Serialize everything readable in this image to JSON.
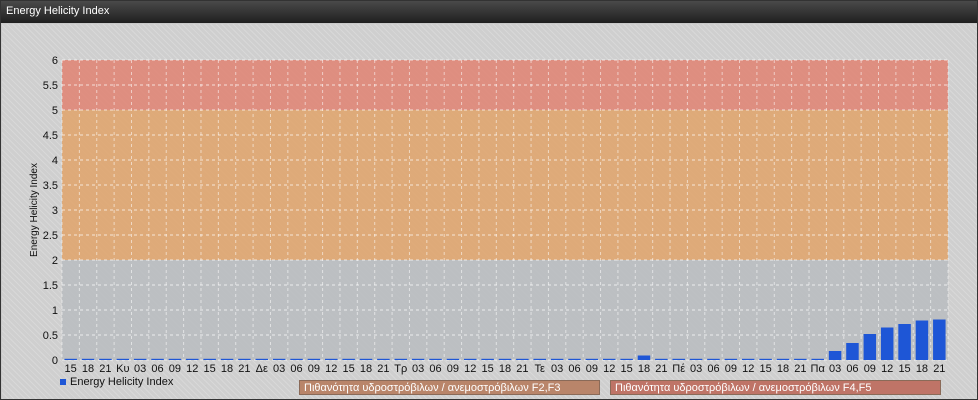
{
  "window": {
    "title": "Energy Helicity Index"
  },
  "legend": {
    "series_label": "Energy Helicity Index"
  },
  "bands": [
    {
      "label": "Πιθανότητα υδροστρόβιλων / ανεμοστρόβιλων F2,F3",
      "color": "#b9856a"
    },
    {
      "label": "Πιθανότητα υδροστρόβιλων / ανεμοστρόβιλων F4,F5",
      "color": "#bf7467"
    }
  ],
  "colors": {
    "bar": "#1e56d6",
    "band_low": "#e0a772",
    "band_high": "#e0897a"
  },
  "chart_data": {
    "type": "bar",
    "title": "",
    "ylabel": "Energy Helicity Index",
    "xlabel": "",
    "ylim": [
      0,
      6
    ],
    "yticks": [
      "0",
      "0.5",
      "1",
      "1.5",
      "2",
      "2.5",
      "3",
      "3.5",
      "4",
      "4.5",
      "5",
      "5.5",
      "6"
    ],
    "y_bands": [
      {
        "from": 2,
        "to": 5,
        "color": "#e0a772"
      },
      {
        "from": 5,
        "to": 6,
        "color": "#e0897a"
      }
    ],
    "grid": true,
    "legend_position": "bottom-left",
    "categories": [
      "15",
      "18",
      "21",
      "Κυ",
      "03",
      "06",
      "09",
      "12",
      "15",
      "18",
      "21",
      "Δε",
      "03",
      "06",
      "09",
      "12",
      "15",
      "18",
      "21",
      "Τρ",
      "03",
      "06",
      "09",
      "12",
      "15",
      "18",
      "21",
      "Τε",
      "03",
      "06",
      "09",
      "12",
      "15",
      "18",
      "21",
      "Πέ",
      "03",
      "06",
      "09",
      "12",
      "15",
      "18",
      "21",
      "Πα",
      "03",
      "06",
      "09",
      "12",
      "15",
      "18",
      "21"
    ],
    "series": [
      {
        "name": "Energy Helicity Index",
        "values": [
          0,
          0,
          0,
          0,
          0,
          0,
          0,
          0,
          0,
          0,
          0,
          0,
          0,
          0,
          0,
          0,
          0,
          0,
          0,
          0,
          0,
          0,
          0,
          0,
          0,
          0,
          0,
          0,
          0,
          0,
          0,
          0,
          0,
          0.09,
          0.02,
          0,
          0,
          0,
          0,
          0,
          0,
          0,
          0,
          0,
          0.18,
          0.34,
          0.52,
          0.65,
          0.72,
          0.79,
          0.81
        ]
      }
    ]
  }
}
